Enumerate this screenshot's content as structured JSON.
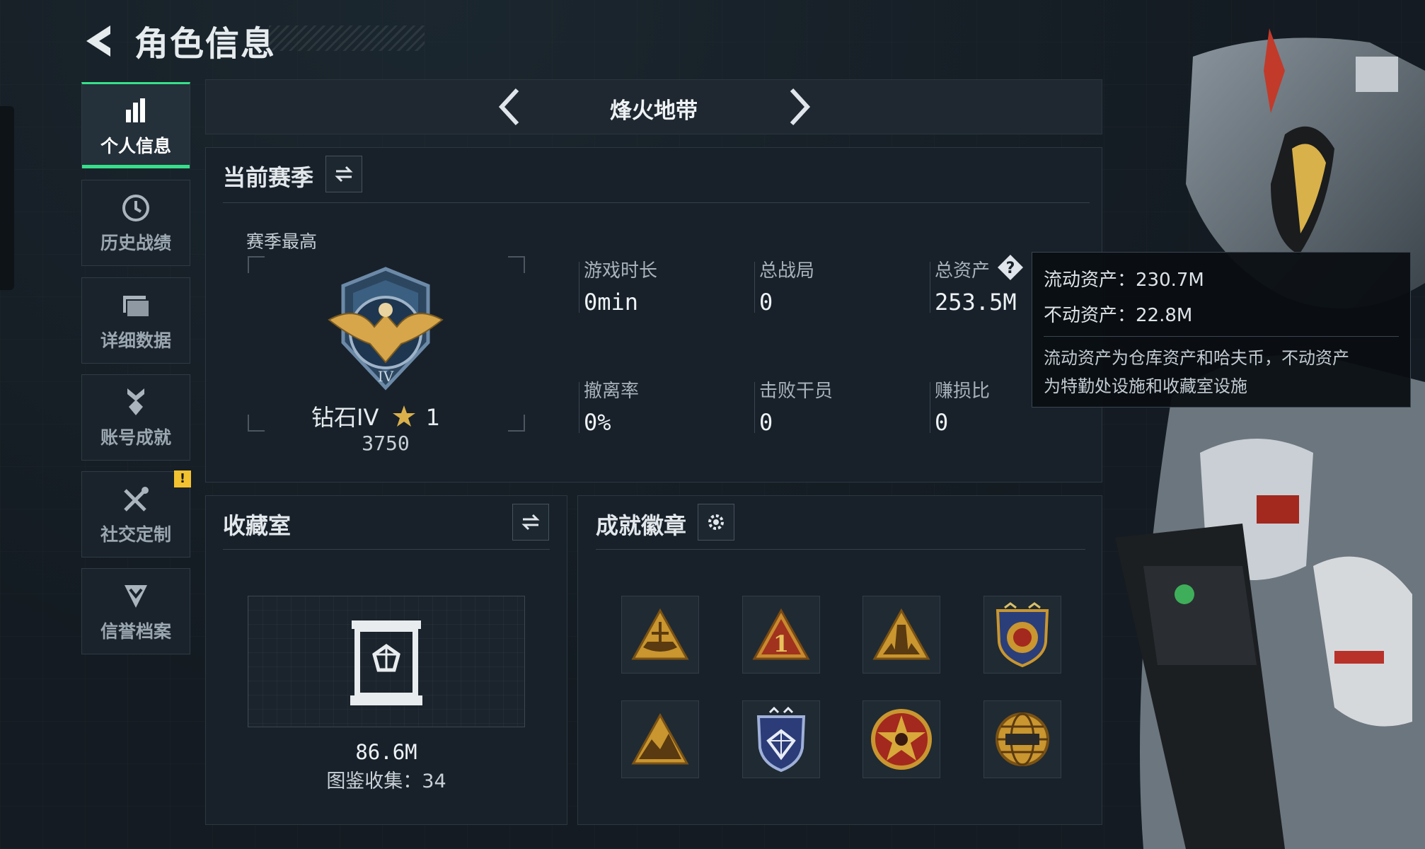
{
  "header": {
    "title": "角色信息"
  },
  "nav": {
    "items": [
      {
        "label": "个人信息",
        "icon": "bar-chart-icon",
        "active": true
      },
      {
        "label": "历史战绩",
        "icon": "clock-icon",
        "active": false
      },
      {
        "label": "详细数据",
        "icon": "folders-icon",
        "active": false
      },
      {
        "label": "账号成就",
        "icon": "medal-icon",
        "active": false
      },
      {
        "label": "社交定制",
        "icon": "tools-icon",
        "active": false,
        "badge": "!"
      },
      {
        "label": "信誉档案",
        "icon": "shield-chevron-icon",
        "active": false
      }
    ]
  },
  "mode": {
    "title": "烽火地带"
  },
  "season": {
    "title": "当前赛季",
    "best_label": "赛季最高",
    "rank": {
      "name": "钻石IV",
      "stars": "1",
      "score": "3750"
    },
    "stats": [
      {
        "label": "游戏时长",
        "value": "0min"
      },
      {
        "label": "总战局",
        "value": "0"
      },
      {
        "label": "总资产",
        "value": "253.5M"
      },
      {
        "label": "撤离率",
        "value": "0%"
      },
      {
        "label": "击败干员",
        "value": "0"
      },
      {
        "label": "赚损比",
        "value": "0"
      }
    ]
  },
  "tooltip": {
    "liquid": "流动资产：230.7M",
    "fixed": "不动资产：22.8M",
    "desc_line1": "流动资产为仓库资产和哈夫币，不动资产",
    "desc_line2": "为特勤处设施和收藏室设施"
  },
  "collection": {
    "title": "收藏室",
    "value": "86.6M",
    "count": "图鉴收集：34"
  },
  "badges": {
    "title": "成就徽章",
    "items": [
      "triangle-ship-badge",
      "triangle-one-badge",
      "triangle-tower-badge",
      "crest-shield-badge",
      "triangle-mountain-badge",
      "diamond-shield-badge",
      "star-skull-badge",
      "globe-2025-badge"
    ]
  },
  "colors": {
    "accent": "#36e08a",
    "gold": "#c9962f",
    "warning": "#f2c230"
  }
}
